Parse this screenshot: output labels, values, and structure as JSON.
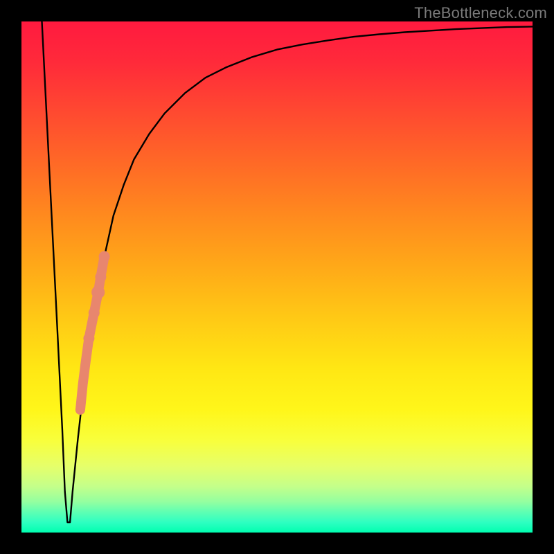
{
  "watermark": "TheBottleneck.com",
  "chart_data": {
    "type": "line",
    "title": "",
    "xlabel": "",
    "ylabel": "",
    "xlim": [
      0,
      100
    ],
    "ylim": [
      0,
      100
    ],
    "grid": false,
    "series": [
      {
        "name": "bottleneck-curve",
        "x": [
          4,
          5,
          6,
          7,
          8,
          8.5,
          9,
          9.5,
          10,
          11,
          12,
          14,
          16,
          18,
          20,
          22,
          25,
          28,
          32,
          36,
          40,
          45,
          50,
          55,
          60,
          65,
          70,
          75,
          80,
          85,
          90,
          95,
          100
        ],
        "y": [
          100,
          80,
          60,
          40,
          20,
          8,
          2,
          2,
          8,
          18,
          27,
          42,
          53,
          62,
          68,
          73,
          78,
          82,
          86,
          89,
          91,
          93,
          94.5,
          95.5,
          96.3,
          97,
          97.5,
          97.9,
          98.2,
          98.5,
          98.7,
          98.9,
          99
        ]
      }
    ],
    "highlight_points": {
      "name": "sample-dots",
      "color": "#e8866e",
      "points": [
        {
          "x": 16.2,
          "y": 54,
          "r": 5
        },
        {
          "x": 15.5,
          "y": 50,
          "r": 5
        },
        {
          "x": 15.0,
          "y": 47,
          "r": 6
        },
        {
          "x": 14.2,
          "y": 43,
          "r": 5
        },
        {
          "x": 13.2,
          "y": 38,
          "r": 5
        },
        {
          "x": 12.5,
          "y": 33,
          "r": 4
        },
        {
          "x": 12.0,
          "y": 29,
          "r": 4
        },
        {
          "x": 11.5,
          "y": 24,
          "r": 4
        }
      ]
    }
  }
}
